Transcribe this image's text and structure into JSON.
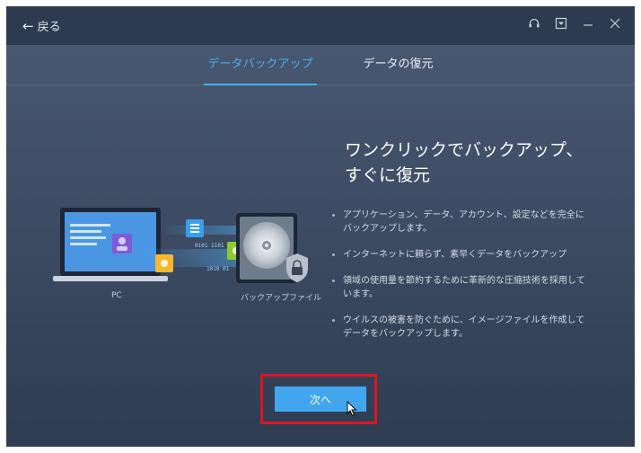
{
  "titlebar": {
    "back_label": "戻る",
    "icons": [
      "headset-icon",
      "dropdown-box-icon",
      "minimize-icon",
      "close-icon"
    ]
  },
  "tabs": [
    {
      "label": "データバックアップ",
      "active": true
    },
    {
      "label": "データの復元",
      "active": false
    }
  ],
  "illustration": {
    "pc_label": "PC",
    "backup_label": "バックアップファイル"
  },
  "main": {
    "heading": "ワンクリックでバックアップ、すぐに復元",
    "bullets": [
      "アプリケーション、データ、アカウント、設定などを完全にバックアップします。",
      "インターネットに頼らず、素早くデータをバックアップ",
      "領域の使用量を節約するために革新的な圧縮技術を採用しています。",
      "ウイルスの被害を防ぐために、イメージファイルを作成してデータをバックアップします。"
    ],
    "next_label": "次へ"
  },
  "colors": {
    "accent": "#46aef2",
    "button": "#42a6ef",
    "highlight": "#e0141e",
    "titlebar": "#2e3a4f"
  }
}
